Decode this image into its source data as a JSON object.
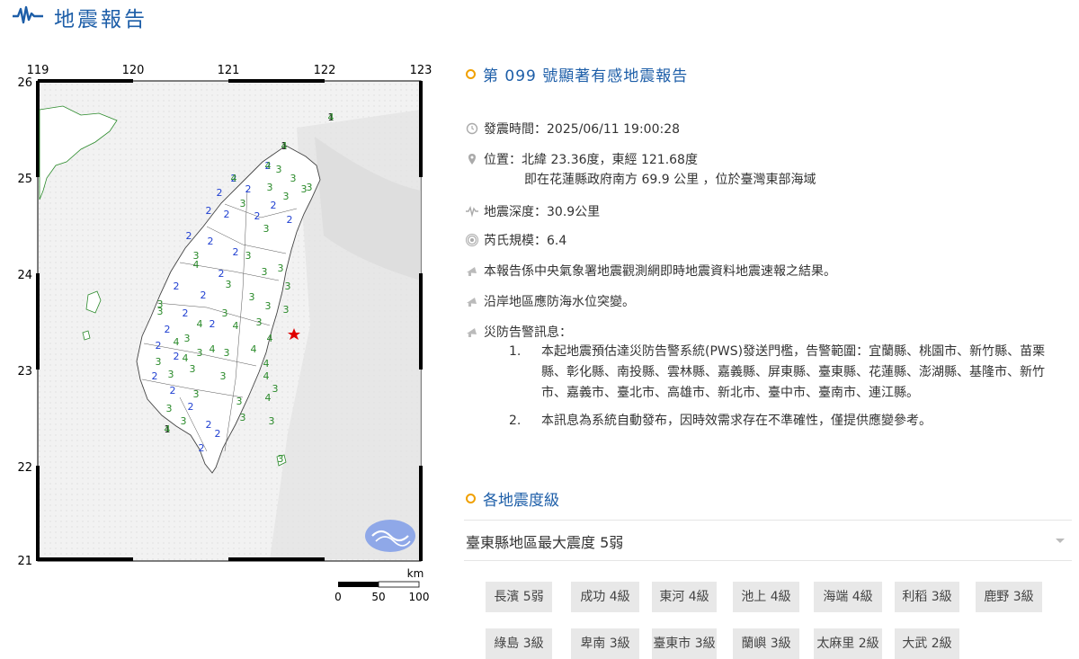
{
  "header": {
    "title": "地震報告",
    "logo_icon": "seismograph-icon"
  },
  "map": {
    "lon_ticks": [
      "119",
      "120",
      "121",
      "122",
      "123"
    ],
    "lat_ticks": [
      "26",
      "25",
      "24",
      "23",
      "22",
      "21"
    ],
    "scale_unit": "km",
    "scale_labels": [
      "0",
      "50",
      "100"
    ],
    "epicenter_icon": "red-star-icon",
    "station_labels": [
      {
        "v": "1",
        "c": "#111"
      },
      {
        "v": "1",
        "c": "#111"
      },
      {
        "v": "1",
        "c": "#111"
      },
      {
        "v": "2",
        "c": "#1f3fd1"
      },
      {
        "v": "2",
        "c": "#1f3fd1"
      },
      {
        "v": "2",
        "c": "#1f3fd1"
      },
      {
        "v": "2",
        "c": "#1f3fd1"
      },
      {
        "v": "2",
        "c": "#1f3fd1"
      },
      {
        "v": "2",
        "c": "#1f3fd1"
      },
      {
        "v": "2",
        "c": "#1f3fd1"
      },
      {
        "v": "2",
        "c": "#1f3fd1"
      },
      {
        "v": "2",
        "c": "#1f3fd1"
      },
      {
        "v": "2",
        "c": "#1f3fd1"
      },
      {
        "v": "2",
        "c": "#1f3fd1"
      },
      {
        "v": "2",
        "c": "#1f3fd1"
      },
      {
        "v": "2",
        "c": "#1f3fd1"
      },
      {
        "v": "2",
        "c": "#1f3fd1"
      },
      {
        "v": "2",
        "c": "#1f3fd1"
      },
      {
        "v": "2",
        "c": "#1f3fd1"
      },
      {
        "v": "2",
        "c": "#1f3fd1"
      },
      {
        "v": "2",
        "c": "#1f3fd1"
      },
      {
        "v": "2",
        "c": "#1f3fd1"
      },
      {
        "v": "2",
        "c": "#1f3fd1"
      },
      {
        "v": "2",
        "c": "#1f3fd1"
      },
      {
        "v": "2",
        "c": "#1f3fd1"
      },
      {
        "v": "2",
        "c": "#1f3fd1"
      },
      {
        "v": "2",
        "c": "#1f3fd1"
      },
      {
        "v": "2",
        "c": "#1f3fd1"
      },
      {
        "v": "2",
        "c": "#1f3fd1"
      },
      {
        "v": "3",
        "c": "#2a8a2a"
      },
      {
        "v": "3",
        "c": "#2a8a2a"
      },
      {
        "v": "3",
        "c": "#2a8a2a"
      },
      {
        "v": "3",
        "c": "#2a8a2a"
      },
      {
        "v": "3",
        "c": "#2a8a2a"
      },
      {
        "v": "3",
        "c": "#2a8a2a"
      },
      {
        "v": "3",
        "c": "#2a8a2a"
      },
      {
        "v": "3",
        "c": "#2a8a2a"
      },
      {
        "v": "3",
        "c": "#2a8a2a"
      },
      {
        "v": "3",
        "c": "#2a8a2a"
      },
      {
        "v": "3",
        "c": "#2a8a2a"
      },
      {
        "v": "3",
        "c": "#2a8a2a"
      },
      {
        "v": "3",
        "c": "#2a8a2a"
      },
      {
        "v": "3",
        "c": "#2a8a2a"
      },
      {
        "v": "3",
        "c": "#2a8a2a"
      },
      {
        "v": "3",
        "c": "#2a8a2a"
      },
      {
        "v": "3",
        "c": "#2a8a2a"
      },
      {
        "v": "3",
        "c": "#2a8a2a"
      },
      {
        "v": "3",
        "c": "#2a8a2a"
      },
      {
        "v": "3",
        "c": "#2a8a2a"
      },
      {
        "v": "3",
        "c": "#2a8a2a"
      },
      {
        "v": "3",
        "c": "#2a8a2a"
      },
      {
        "v": "3",
        "c": "#2a8a2a"
      },
      {
        "v": "3",
        "c": "#2a8a2a"
      },
      {
        "v": "3",
        "c": "#2a8a2a"
      },
      {
        "v": "3",
        "c": "#2a8a2a"
      },
      {
        "v": "3",
        "c": "#2a8a2a"
      },
      {
        "v": "3",
        "c": "#2a8a2a"
      },
      {
        "v": "3",
        "c": "#2a8a2a"
      },
      {
        "v": "3",
        "c": "#2a8a2a"
      },
      {
        "v": "3",
        "c": "#2a8a2a"
      },
      {
        "v": "3",
        "c": "#2a8a2a"
      },
      {
        "v": "3",
        "c": "#2a8a2a"
      },
      {
        "v": "3",
        "c": "#2a8a2a"
      },
      {
        "v": "3",
        "c": "#2a8a2a"
      },
      {
        "v": "3",
        "c": "#2a8a2a"
      },
      {
        "v": "4",
        "c": "#2a8a2a"
      },
      {
        "v": "4",
        "c": "#2a8a2a"
      },
      {
        "v": "4",
        "c": "#2a8a2a"
      },
      {
        "v": "4",
        "c": "#2a8a2a"
      },
      {
        "v": "4",
        "c": "#2a8a2a"
      },
      {
        "v": "4",
        "c": "#2a8a2a"
      },
      {
        "v": "4",
        "c": "#2a8a2a"
      },
      {
        "v": "4",
        "c": "#2a8a2a"
      },
      {
        "v": "4",
        "c": "#2a8a2a"
      },
      {
        "v": "4",
        "c": "#2a8a2a"
      },
      {
        "v": "4",
        "c": "#2a8a2a"
      },
      {
        "v": "4",
        "c": "#2a8a2a"
      },
      {
        "v": "4",
        "c": "#2a8a2a"
      },
      {
        "v": "4",
        "c": "#2a8a2a"
      },
      {
        "v": "4",
        "c": "#2a8a2a"
      },
      {
        "v": "4",
        "c": "#2a8a2a"
      }
    ]
  },
  "report": {
    "title": "第 099 號顯著有感地震報告",
    "time": "發震時間：2025/06/11 19:00:28",
    "location": "位置：北緯 23.36度，東經 121.68度",
    "location_detail": "即在花蓮縣政府南方 69.9 公里 ，位於臺灣東部海域",
    "depth": "地震深度：30.9公里",
    "magnitude": "芮氏規模：6.4",
    "note1": "本報告係中央氣象署地震觀測網即時地震資料地震速報之結果。",
    "note2": "沿岸地區應防海水位突變。",
    "warning_label": "災防告警訊息：",
    "warnings": [
      {
        "num": "1.",
        "text": "本起地震預估達災防告警系統(PWS)發送門檻，告警範圍：宜蘭縣、桃園市、新竹縣、苗栗縣、彰化縣、南投縣、雲林縣、嘉義縣、屏東縣、臺東縣、花蓮縣、澎湖縣、基隆市、新竹市、嘉義市、臺北市、高雄市、新北市、臺中市、臺南市、連江縣。"
      },
      {
        "num": "2.",
        "text": "本訊息為系統自動發布，因時效需求存在不準確性，僅提供應變參考。"
      }
    ]
  },
  "intensity": {
    "section_title": "各地震度級",
    "region_label": "臺東縣地區最大震度 5弱",
    "stations": [
      "長濱 5弱",
      "成功 4級",
      "東河 4級",
      "池上 4級",
      "海端 4級",
      "利稻 3級",
      "鹿野 3級",
      "綠島 3級",
      "卑南 3級",
      "臺東市 3級",
      "蘭嶼 3級",
      "太麻里 2級",
      "大武 2級"
    ]
  },
  "colors": {
    "accent": "#1d5ea8",
    "dot": "#f0a000",
    "epicenter": "#e00000",
    "chip_bg": "#e8e8e8"
  }
}
